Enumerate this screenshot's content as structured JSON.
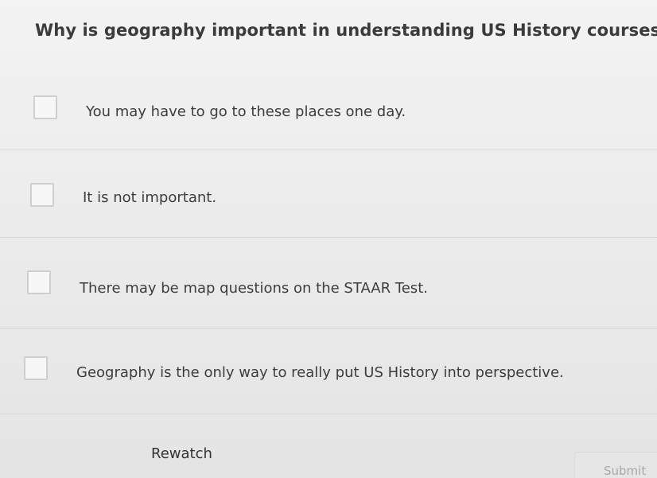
{
  "question": {
    "text": "Why is geography important in understanding US History courses?"
  },
  "options": [
    {
      "label": "You may have to go to these places one day.",
      "checked": false
    },
    {
      "label": "It is not important.",
      "checked": false
    },
    {
      "label": "There may be map questions on the STAAR Test.",
      "checked": false
    },
    {
      "label": "Geography is the only way to really put US History into perspective.",
      "checked": false
    }
  ],
  "actions": {
    "rewatch_label": "Rewatch",
    "submit_label": "Submit",
    "submit_enabled": false
  }
}
